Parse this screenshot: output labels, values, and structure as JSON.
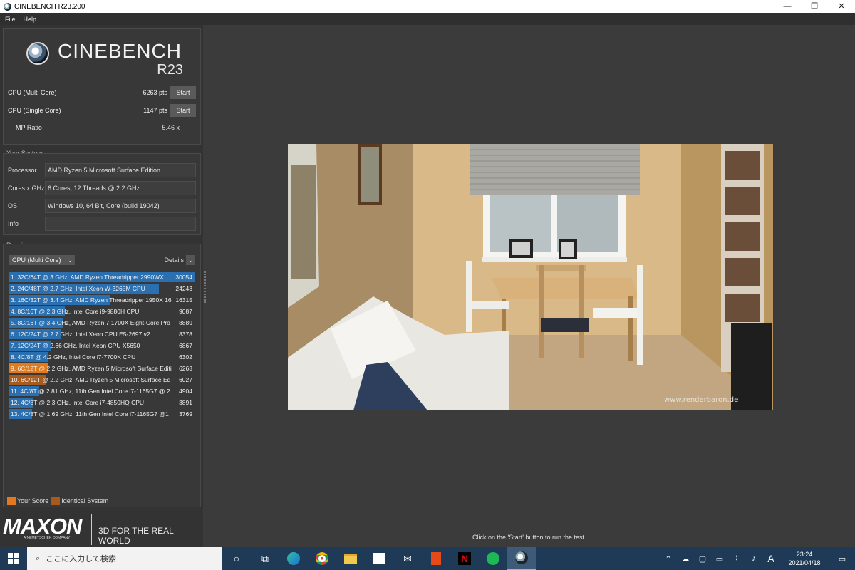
{
  "window": {
    "title": "CINEBENCH R23.200",
    "minimize": "—",
    "restore": "❐",
    "close": "✕"
  },
  "menu": [
    "File",
    "Help"
  ],
  "logo": {
    "brand": "CINEBENCH",
    "version": "R23"
  },
  "scores": {
    "multi": {
      "label": "CPU (Multi Core)",
      "value": "6263 pts",
      "button": "Start"
    },
    "single": {
      "label": "CPU (Single Core)",
      "value": "1147 pts",
      "button": "Start"
    },
    "mp": {
      "label": "MP Ratio",
      "value": "5.46  x"
    }
  },
  "system": {
    "title": "Your System",
    "rows": [
      {
        "key": "Processor",
        "value": "AMD Ryzen 5 Microsoft Surface Edition"
      },
      {
        "key": "Cores x GHz",
        "value": "6 Cores, 12 Threads @ 2.2 GHz"
      },
      {
        "key": "OS",
        "value": "Windows 10, 64 Bit, Core (build 19042)"
      },
      {
        "key": "Info",
        "value": ""
      }
    ]
  },
  "ranking": {
    "title": "Ranking",
    "select": "CPU (Multi Core)",
    "details": "Details",
    "items": [
      {
        "label": "1. 32C/64T @ 3 GHz, AMD Ryzen Threadripper 2990WX",
        "score": "30054",
        "value": 30054,
        "kind": "other"
      },
      {
        "label": "2. 24C/48T @ 2.7 GHz, Intel Xeon W-3265M CPU",
        "score": "24243",
        "value": 24243,
        "kind": "other"
      },
      {
        "label": "3. 16C/32T @ 3.4 GHz, AMD Ryzen Threadripper 1950X 16",
        "score": "16315",
        "value": 16315,
        "kind": "other"
      },
      {
        "label": "4. 8C/16T @ 2.3 GHz, Intel Core i9-9880H CPU",
        "score": "9087",
        "value": 9087,
        "kind": "other"
      },
      {
        "label": "5. 8C/16T @ 3.4 GHz, AMD Ryzen 7 1700X Eight-Core Pro",
        "score": "8889",
        "value": 8889,
        "kind": "other"
      },
      {
        "label": "6. 12C/24T @ 2.7 GHz, Intel Xeon CPU E5-2697 v2",
        "score": "8378",
        "value": 8378,
        "kind": "other"
      },
      {
        "label": "7. 12C/24T @ 2.66 GHz, Intel Xeon CPU X5650",
        "score": "6867",
        "value": 6867,
        "kind": "other"
      },
      {
        "label": "8. 4C/8T @ 4.2 GHz, Intel Core i7-7700K CPU",
        "score": "6302",
        "value": 6302,
        "kind": "other"
      },
      {
        "label": "9. 6C/12T @ 2.2 GHz, AMD Ryzen 5 Microsoft Surface Editi",
        "score": "6263",
        "value": 6263,
        "kind": "yours"
      },
      {
        "label": "10. 6C/12T @ 2.2 GHz, AMD Ryzen 5 Microsoft Surface Ed",
        "score": "6027",
        "value": 6027,
        "kind": "identical"
      },
      {
        "label": "11. 4C/8T @ 2.81 GHz, 11th Gen Intel Core i7-1165G7 @ 2",
        "score": "4904",
        "value": 4904,
        "kind": "other"
      },
      {
        "label": "12. 4C/8T @ 2.3 GHz, Intel Core i7-4850HQ CPU",
        "score": "3891",
        "value": 3891,
        "kind": "other"
      },
      {
        "label": "13. 4C/8T @ 1.69 GHz, 11th Gen Intel Core i7-1165G7 @1",
        "score": "3769",
        "value": 3769,
        "kind": "other"
      }
    ],
    "max": 30054
  },
  "legend": {
    "your_score": "Your Score",
    "identical": "Identical System"
  },
  "colors": {
    "other": "#2a6fb0",
    "yours": "#e07a1c",
    "identical": "#a55a1e"
  },
  "maxon": {
    "brand": "MAXON",
    "sub": "A NEMETSCHEK COMPANY",
    "tagline": "3D FOR THE REAL WORLD"
  },
  "render": {
    "watermark": "www.renderbaron.de"
  },
  "hint": "Click on the 'Start' button to run the test.",
  "taskbar": {
    "search_placeholder": "ここに入力して検索",
    "time": "23:24",
    "date": "2021/04/18",
    "ime": "A"
  }
}
